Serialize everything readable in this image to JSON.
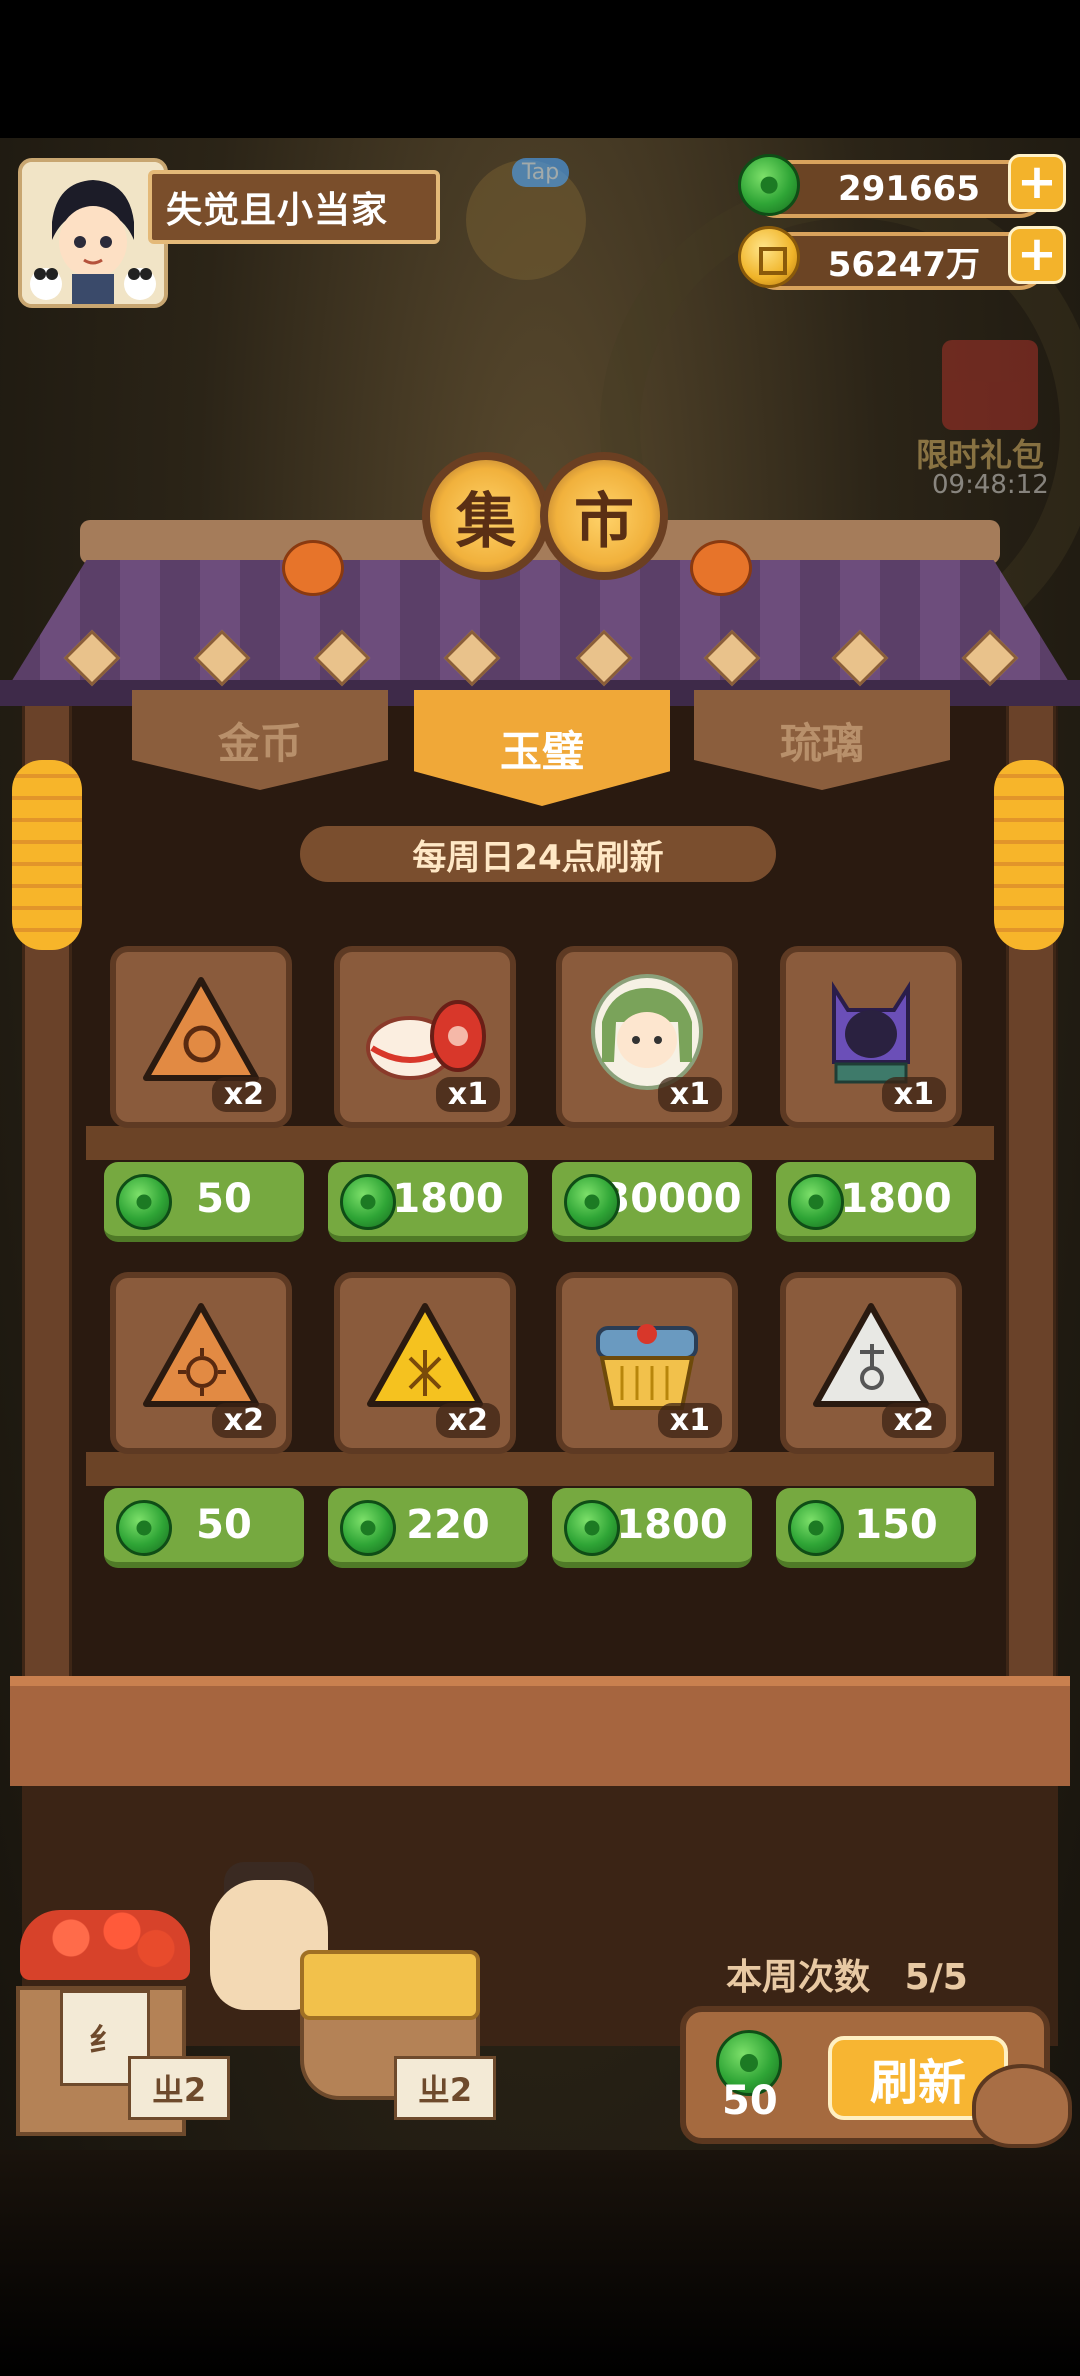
{
  "player": {
    "name": "失觉且小当家",
    "avatar_icon": "player-portrait-icon"
  },
  "currencies": {
    "jade": {
      "value": "291665",
      "icon": "jade-coin-icon"
    },
    "gold": {
      "value": "56247万",
      "icon": "gold-coin-icon"
    },
    "add_label": "+"
  },
  "overlay": {
    "tap_hint": "Tap",
    "gift_label": "限时礼包",
    "gift_timer": "09:48:12"
  },
  "title": {
    "char1": "集",
    "char2": "市"
  },
  "tabs": [
    {
      "label": "金币",
      "active": false
    },
    {
      "label": "玉璧",
      "active": true
    },
    {
      "label": "琉璃",
      "active": false
    }
  ],
  "refresh_notice": "每周日24点刷新",
  "items": [
    {
      "name": "orange-rice-ball",
      "qty": "x2",
      "price": "50"
    },
    {
      "name": "porcelain-bowl",
      "qty": "x1",
      "price": "1800"
    },
    {
      "name": "green-hair-doll",
      "qty": "x1",
      "price": "30000"
    },
    {
      "name": "purple-cat-mirror",
      "qty": "x1",
      "price": "1800"
    },
    {
      "name": "sun-rice-ball",
      "qty": "x2",
      "price": "50"
    },
    {
      "name": "golden-rice-ball",
      "qty": "x2",
      "price": "220"
    },
    {
      "name": "jade-chest",
      "qty": "x1",
      "price": "1800"
    },
    {
      "name": "white-rice-ball",
      "qty": "x2",
      "price": "150"
    }
  ],
  "refresh": {
    "week_label": "本周次数",
    "week_count": "5/5",
    "cost": "50",
    "button_label": "刷新"
  },
  "props": {
    "tag_left": "ㄓ2",
    "tag_right": "ㄓ2",
    "sign": "纟"
  },
  "colors": {
    "jade_green": "#2fa536",
    "price_green": "#76a940",
    "tab_active": "#f0a838",
    "roof_purple": "#5b3f68"
  }
}
